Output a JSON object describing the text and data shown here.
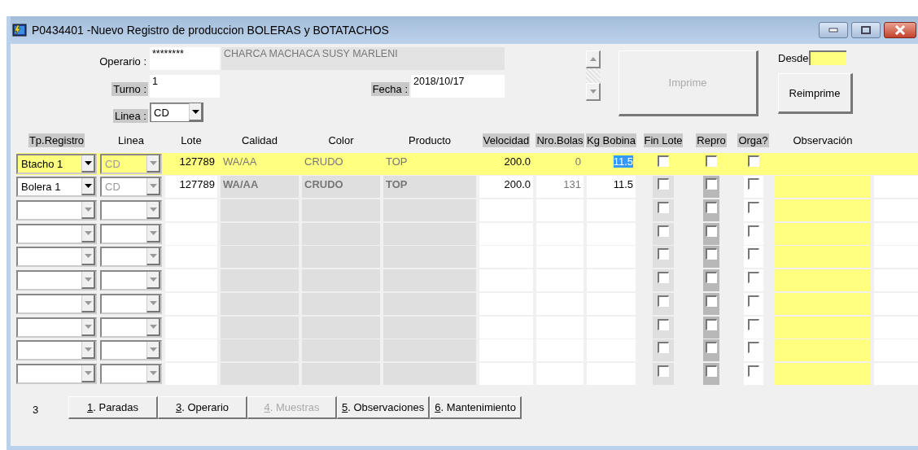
{
  "window": {
    "title": "P0434401 -Nuevo Registro de produccion BOLERAS y BOTATACHOS"
  },
  "form": {
    "operario": {
      "label": "Operario :",
      "code": "********",
      "name": "CHARCA MACHACA SUSY MARLENI",
      "shaded": false
    },
    "turno": {
      "label": "Turno :",
      "value": "1",
      "shaded": true
    },
    "linea": {
      "label": "Linea :",
      "value": "CD",
      "shaded": true
    },
    "fecha": {
      "label": "Fecha :",
      "value": "2018/10/17",
      "shaded": true
    },
    "imprime": {
      "label": "Imprime",
      "disabled": true
    },
    "desde": {
      "label": "Desde"
    },
    "reimprime": {
      "label": "Reimprime",
      "disabled": false
    }
  },
  "table": {
    "columns": [
      {
        "label": "Tp.Registro",
        "shaded": true
      },
      {
        "label": "Linea",
        "shaded": false
      },
      {
        "label": "Lote",
        "shaded": false
      },
      {
        "label": "Calidad",
        "shaded": false
      },
      {
        "label": "Color",
        "shaded": false
      },
      {
        "label": "Producto",
        "shaded": false
      },
      {
        "label": "Velocidad",
        "shaded": true
      },
      {
        "label": "Nro.Bolas",
        "shaded": true
      },
      {
        "label": "Kg Bobina",
        "shaded": true
      },
      {
        "label": "Fin Lote",
        "shaded": true
      },
      {
        "label": "Repro",
        "shaded": true
      },
      {
        "label": "Orga?",
        "shaded": true
      },
      {
        "label": "Observación",
        "shaded": false
      }
    ],
    "rows": [
      {
        "selected": true,
        "tp": "Btacho 1",
        "linea": "CD",
        "lote": "127789",
        "calidad": "WA/AA",
        "product_color": "CRUDO",
        "producto": "TOP",
        "velocidad": "200.0",
        "bolas": "0",
        "kg": "11.5",
        "fin_lote": false,
        "repro": false,
        "orga": false
      },
      {
        "selected": false,
        "tp": "Bolera 1",
        "linea": "CD",
        "lote": "127789",
        "calidad": "WA/AA",
        "product_color": "CRUDO",
        "producto": "TOP",
        "velocidad": "200.0",
        "bolas": "131",
        "kg": "11.5",
        "fin_lote": false,
        "repro": false,
        "orga": false
      },
      {
        "selected": false,
        "fin_lote": false,
        "repro": false,
        "orga": false
      },
      {
        "selected": false,
        "fin_lote": false,
        "repro": false,
        "orga": false
      },
      {
        "selected": false,
        "fin_lote": false,
        "repro": false,
        "orga": false
      },
      {
        "selected": false,
        "fin_lote": false,
        "repro": false,
        "orga": false
      },
      {
        "selected": false,
        "fin_lote": false,
        "repro": false,
        "orga": false
      },
      {
        "selected": false,
        "fin_lote": false,
        "repro": false,
        "orga": false
      },
      {
        "selected": false,
        "fin_lote": false,
        "repro": false,
        "orga": false
      },
      {
        "selected": false,
        "fin_lote": false,
        "repro": false,
        "orga": false
      }
    ]
  },
  "footer": {
    "count": "3",
    "buttons": [
      {
        "key": "1",
        "label": ". Paradas",
        "disabled": false
      },
      {
        "key": "3",
        "label": ". Operario",
        "disabled": false
      },
      {
        "key": "4",
        "label": ". Muestras",
        "disabled": true
      },
      {
        "key": "5",
        "label": ". Observaciones",
        "disabled": false
      },
      {
        "key": "6",
        "label": ". Mantenimiento",
        "disabled": false
      }
    ]
  }
}
